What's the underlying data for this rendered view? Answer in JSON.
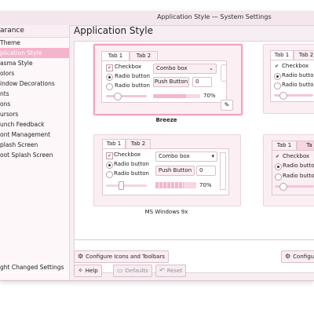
{
  "window": {
    "title": "Application Style — System Settings"
  },
  "sidebar": {
    "header": "arance",
    "items": [
      {
        "label": " Theme",
        "active": false
      },
      {
        "label": "plication Style",
        "active": true
      },
      {
        "label": "asma Style",
        "active": false
      },
      {
        "label": "olors",
        "active": false
      },
      {
        "label": "indow Decorations",
        "active": false
      },
      {
        "label": "nts",
        "active": false
      },
      {
        "label": "ons",
        "active": false
      },
      {
        "label": "ursors",
        "active": false
      },
      {
        "label": "unch Feedback",
        "active": false
      },
      {
        "label": "ont Management",
        "active": false
      },
      {
        "label": "plash Screen",
        "active": false
      },
      {
        "label": "oot Splash Screen",
        "active": false
      }
    ],
    "footer": "ght Changed Settings"
  },
  "main": {
    "title": "Application Style",
    "previews": [
      {
        "caption": "Breeze",
        "tab1": "Tab 1",
        "tab2": "Tab 2",
        "checkbox": "Checkbox",
        "radio1": "Radio button",
        "radio2": "Radio button",
        "combo": "Combo box",
        "push": "Push Button",
        "spin": "0",
        "pct": "70%"
      },
      {
        "caption": "MS Windows 9x",
        "tab1": "Tab 1",
        "tab2": "Tab 2",
        "checkbox": "Checkbox",
        "radio1": "Radio button",
        "radio2": "Radio button",
        "combo": "Combo box",
        "push": "Push Button",
        "spin": "0",
        "pct": "70%"
      },
      {
        "tab1": "Tab 1",
        "tab2": "Tab 2",
        "checkbox": "Checkbox",
        "radio1": "Radio button",
        "radio2": "Radio button"
      },
      {
        "tab1": "Tab 1",
        "tab2": "Ta",
        "checkbox": "Checkbox",
        "radio1": "Radio button",
        "radio2": "Radio button"
      }
    ],
    "configure_icons": "Configure Icons and Toolbars",
    "configure_right": "Configu"
  },
  "footer": {
    "help": "Help",
    "defaults": "Defaults",
    "reset": "Reset"
  },
  "icons": {
    "edit": "pencil-icon",
    "help": "help-icon",
    "defaults": "defaults-icon",
    "reset": "reset-icon",
    "configure": "configure-icon"
  },
  "colors": {
    "accent": "#f5b3cc",
    "selected_border": "#f0a3bf"
  }
}
